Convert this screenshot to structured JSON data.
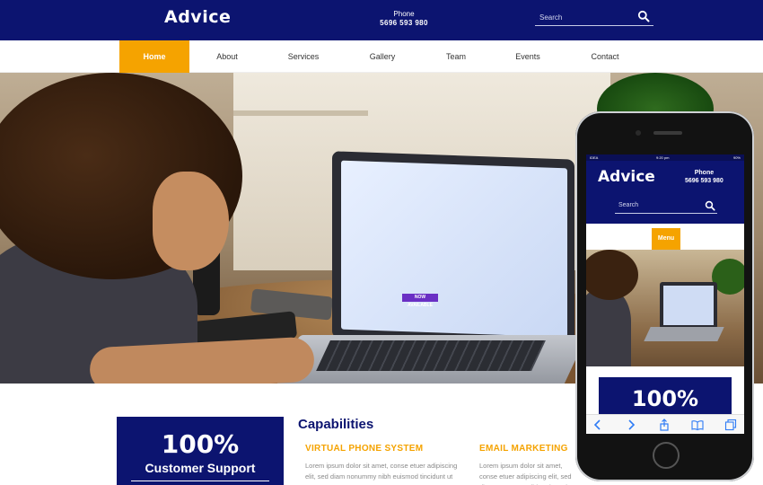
{
  "header": {
    "brand": "Advice",
    "phone_label": "Phone",
    "phone_number": "5696 593 980",
    "search_placeholder": "Search"
  },
  "nav": {
    "items": [
      "Home",
      "About",
      "Services",
      "Gallery",
      "Team",
      "Events",
      "Contact"
    ],
    "active": "Home"
  },
  "hero": {
    "screen_badge": "NOW AVAILABLE"
  },
  "capabilities": {
    "stat_value": "100%",
    "stat_label": "Customer Support",
    "title": "Capabilities",
    "features": [
      {
        "heading": "VIRTUAL PHONE SYSTEM",
        "text": "Lorem ipsum dolor sit amet, conse etuer adipiscing elit, sed diam nonummy nibh euismod tincidunt ut"
      },
      {
        "heading": "EMAIL MARKETING",
        "text": "Lorem ipsum dolor sit amet, conse etuer adipiscing elit, sed diam nonummy nibh euismod tincidunt ut"
      }
    ]
  },
  "mobile": {
    "carrier": "IDEA",
    "time": "9:20 pm",
    "battery": "90%",
    "brand": "Advice",
    "phone_label": "Phone",
    "phone_number": "5696 593 980",
    "search_placeholder": "Search",
    "menu_label": "Menu",
    "stat_value": "100%"
  },
  "colors": {
    "primary": "#0c1470",
    "accent": "#f5a300"
  },
  "icons": {
    "search": "search-icon",
    "back": "back-arrow-icon",
    "forward": "forward-arrow-icon",
    "share": "share-icon",
    "bookmarks": "book-icon",
    "tabs": "tabs-icon"
  }
}
